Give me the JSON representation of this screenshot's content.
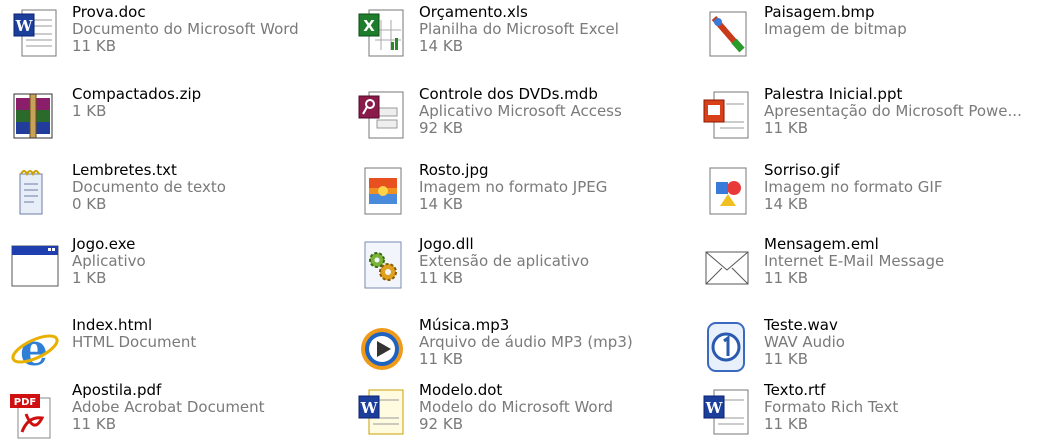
{
  "files": [
    [
      {
        "name": "Prova.doc",
        "type": "Documento do Microsoft Word",
        "size": "11 KB",
        "icon": "word-doc-icon"
      },
      {
        "name": "Compactados.zip",
        "type": "",
        "size": "1 KB",
        "icon": "winrar-archive-icon"
      },
      {
        "name": "Lembretes.txt",
        "type": "Documento de texto",
        "size": "0 KB",
        "icon": "notepad-text-icon"
      },
      {
        "name": "Jogo.exe",
        "type": "Aplicativo",
        "size": "1 KB",
        "icon": "application-window-icon"
      },
      {
        "name": "Index.html",
        "type": "HTML Document",
        "size": "",
        "icon": "internet-explorer-icon"
      },
      {
        "name": "Apostila.pdf",
        "type": "Adobe Acrobat Document",
        "size": "11 KB",
        "icon": "pdf-icon"
      }
    ],
    [
      {
        "name": "Orçamento.xls",
        "type": "Planilha do Microsoft Excel",
        "size": "14 KB",
        "icon": "excel-sheet-icon"
      },
      {
        "name": "Controle dos DVDs.mdb",
        "type": "Aplicativo Microsoft Access",
        "size": "92 KB",
        "icon": "access-database-icon"
      },
      {
        "name": "Rosto.jpg",
        "type": "Imagem no formato JPEG",
        "size": "14 KB",
        "icon": "jpeg-image-icon"
      },
      {
        "name": "Jogo.dll",
        "type": "Extensão de aplicativo",
        "size": "11 KB",
        "icon": "dll-gears-icon"
      },
      {
        "name": "Música.mp3",
        "type": "Arquivo de áudio MP3 (mp3)",
        "size": "11 KB",
        "icon": "media-player-icon"
      },
      {
        "name": "Modelo.dot",
        "type": "Modelo do Microsoft Word",
        "size": "92 KB",
        "icon": "word-template-icon"
      }
    ],
    [
      {
        "name": "Paisagem.bmp",
        "type": "Imagem de bitmap",
        "size": "",
        "icon": "paint-brush-icon"
      },
      {
        "name": "Palestra Inicial.ppt",
        "type": "Apresentação do Microsoft Powe...",
        "size": "11 KB",
        "icon": "powerpoint-icon"
      },
      {
        "name": "Sorriso.gif",
        "type": "Imagem no formato GIF",
        "size": "14 KB",
        "icon": "gif-image-icon"
      },
      {
        "name": "Mensagem.eml",
        "type": "Internet E-Mail Message",
        "size": "11 KB",
        "icon": "email-envelope-icon"
      },
      {
        "name": "Teste.wav",
        "type": "WAV Audio",
        "size": "11 KB",
        "icon": "wav-audio-icon"
      },
      {
        "name": "Texto.rtf",
        "type": "Formato Rich Text",
        "size": "11 KB",
        "icon": "wordpad-rtf-icon"
      }
    ]
  ]
}
